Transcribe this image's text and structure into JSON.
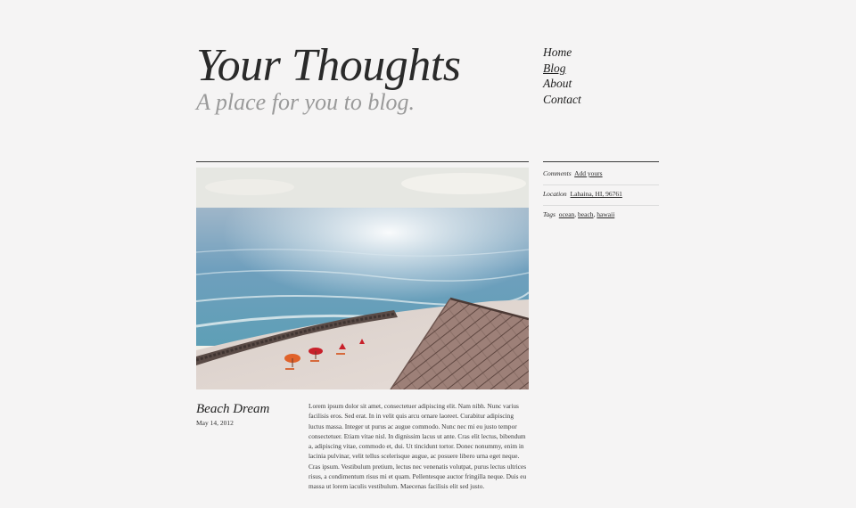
{
  "site": {
    "title": "Your Thoughts",
    "tagline": "A place for you to blog."
  },
  "nav": {
    "items": [
      {
        "label": "Home",
        "active": false
      },
      {
        "label": "Blog",
        "active": true
      },
      {
        "label": "About",
        "active": false
      },
      {
        "label": "Contact",
        "active": false
      }
    ]
  },
  "post": {
    "image_alt": "beach photo",
    "title": "Beach Dream",
    "date": "May 14, 2012",
    "body": "Lorem ipsum dolor sit amet, consectetuer adipiscing elit. Nam nibh. Nunc varius facilisis eros. Sed erat. In in velit quis arcu ornare laoreet. Curabitur adipiscing luctus massa. Integer ut purus ac augue commodo. Nunc nec mi eu justo tempor consectetuer. Etiam vitae nisl. In dignissim lacus ut ante. Cras elit lectus, bibendum a, adipiscing vitae, commodo et, dui. Ut tincidunt tortor. Donec nonummy, enim in lacinia pulvinar, velit tellus scelerisque augue, ac posuere libero urna eget neque. Cras ipsum. Vestibulum pretium, lectus nec venenatis volutpat, purus lectus ultrices risus, a condimentum risus mi et quam. Pellentesque auctor fringilla neque. Duis eu massa ut lorem iaculis vestibulum. Maecenas facilisis elit sed justo."
  },
  "sidebar": {
    "comments_label": "Comments",
    "comments_link": "Add yours",
    "location_label": "Location",
    "location_value": "Lahaina, HI, 96761",
    "tags_label": "Tags",
    "tags": [
      "ocean",
      "beach",
      "hawaii"
    ]
  },
  "colors": {
    "background": "#f5f4f4",
    "text": "#2b2b2b",
    "tagline": "#9a9a9a",
    "rule": "#3a3a3a"
  }
}
